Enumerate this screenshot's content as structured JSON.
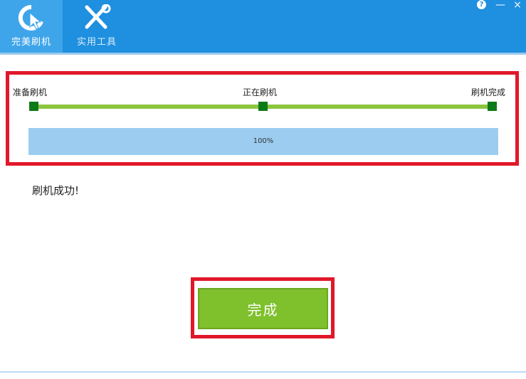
{
  "colors": {
    "titlebar": "#1f8fdf",
    "active_tab": "#3fa5ea",
    "track": "#8cc63f",
    "node": "#0d7a18",
    "progress_fill": "#9ccdf0",
    "highlight": "#e0182a",
    "button": "#7fc02d"
  },
  "tabs": [
    {
      "label": "完美刷机",
      "icon": "flash-refresh-icon",
      "active": true
    },
    {
      "label": "实用工具",
      "icon": "tools-icon",
      "active": false
    }
  ],
  "window_controls": {
    "help": "?",
    "minimize": "—",
    "close": "×"
  },
  "steps": [
    {
      "label": "准备刷机"
    },
    {
      "label": "正在刷机"
    },
    {
      "label": "刷机完成"
    }
  ],
  "progress": {
    "text": "100%",
    "value": 1.0
  },
  "status_text": "刷机成功!",
  "done_button": "完成"
}
